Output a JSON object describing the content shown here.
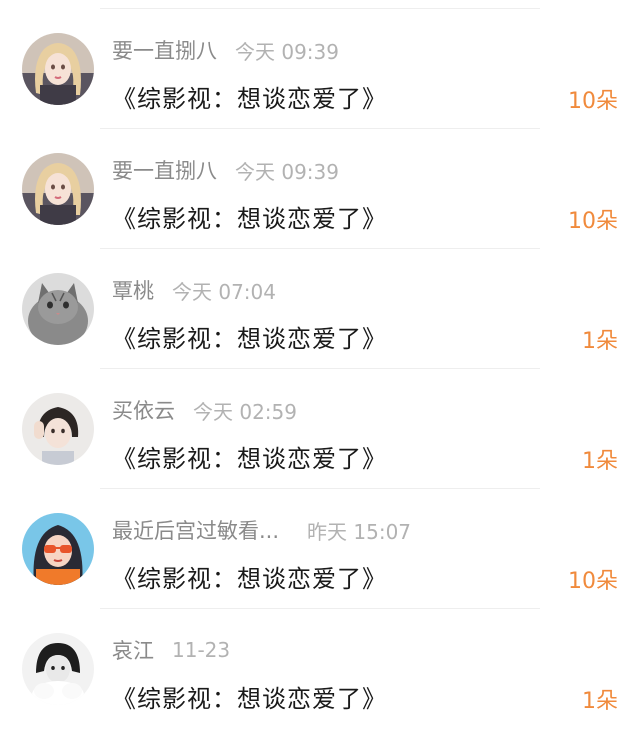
{
  "items": [
    {
      "username": "要一直捌八",
      "time": "今天 09:39",
      "title": "《综影视：想谈恋爱了》",
      "count": "10朵",
      "avatar_icon": "blonde-girl-avatar-icon"
    },
    {
      "username": "要一直捌八",
      "time": "今天 09:39",
      "title": "《综影视：想谈恋爱了》",
      "count": "10朵",
      "avatar_icon": "blonde-girl-avatar-icon"
    },
    {
      "username": "覃桃",
      "time": "今天 07:04",
      "title": "《综影视：想谈恋爱了》",
      "count": "1朵",
      "avatar_icon": "kitten-avatar-icon"
    },
    {
      "username": "买依云",
      "time": "今天 02:59",
      "title": "《综影视：想谈恋爱了》",
      "count": "1朵",
      "avatar_icon": "girl-peace-sign-avatar-icon"
    },
    {
      "username": "最近后宫过敏看...",
      "time": "昨天 15:07",
      "title": "《综影视：想谈恋爱了》",
      "count": "10朵",
      "avatar_icon": "cartoon-girl-sunglasses-avatar-icon"
    },
    {
      "username": "哀江",
      "time": "11-23",
      "title": "《综影视：想谈恋爱了》",
      "count": "1朵",
      "avatar_icon": "monochrome-portrait-avatar-icon"
    }
  ],
  "colors": {
    "count": "#f08a3c",
    "username": "#8a8a8a",
    "time": "#b2b2b2",
    "title": "#1a1a1a",
    "divider": "#eeeeee"
  }
}
